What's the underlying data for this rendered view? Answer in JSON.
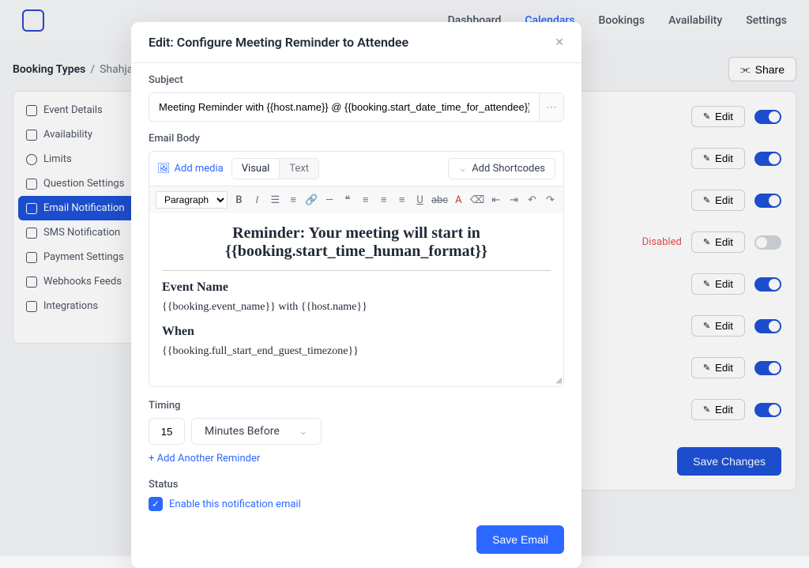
{
  "nav": [
    "Dashboard",
    "Calendars",
    "Bookings",
    "Availability",
    "Settings"
  ],
  "nav_active": 1,
  "breadcrumbs": {
    "root": "Booking Types",
    "sep": "/",
    "current": "Shahjahan J"
  },
  "share_label": "Share",
  "sidebar": [
    {
      "label": "Event Details"
    },
    {
      "label": "Availability"
    },
    {
      "label": "Limits"
    },
    {
      "label": "Question Settings"
    },
    {
      "label": "Email Notification"
    },
    {
      "label": "SMS Notification"
    },
    {
      "label": "Payment Settings"
    },
    {
      "label": "Webhooks Feeds"
    },
    {
      "label": "Integrations"
    }
  ],
  "sidebar_active": 4,
  "edit_label": "Edit",
  "disabled_label": "Disabled",
  "save_changes": "Save Changes",
  "rows": [
    {
      "on": true
    },
    {
      "on": true
    },
    {
      "on": true
    },
    {
      "disabled": true,
      "on": false
    },
    {
      "on": true
    },
    {
      "on": true
    },
    {
      "on": true
    },
    {
      "on": true
    }
  ],
  "modal": {
    "title": "Edit: Configure Meeting Reminder to Attendee",
    "subject_label": "Subject",
    "subject_value": "Meeting Reminder with {{host.name}} @ {{booking.start_date_time_for_attendee}}",
    "body_label": "Email Body",
    "add_media": "Add media",
    "tab_visual": "Visual",
    "tab_text": "Text",
    "shortcodes": "Add Shortcodes",
    "format_paragraph": "Paragraph",
    "editor": {
      "heading_line1": "Reminder: Your meeting will start in",
      "heading_line2": "{{booking.start_time_human_format}}",
      "event_name_label": "Event Name",
      "event_name_value": "{{booking.event_name}} with {{host.name}}",
      "when_label": "When",
      "when_value": "{{booking.full_start_end_guest_timezone}}"
    },
    "timing_label": "Timing",
    "timing_value": "15",
    "timing_unit": "Minutes Before",
    "add_another": "+ Add Another Reminder",
    "status_label": "Status",
    "enable_label": "Enable this notification email",
    "save_email": "Save Email"
  }
}
